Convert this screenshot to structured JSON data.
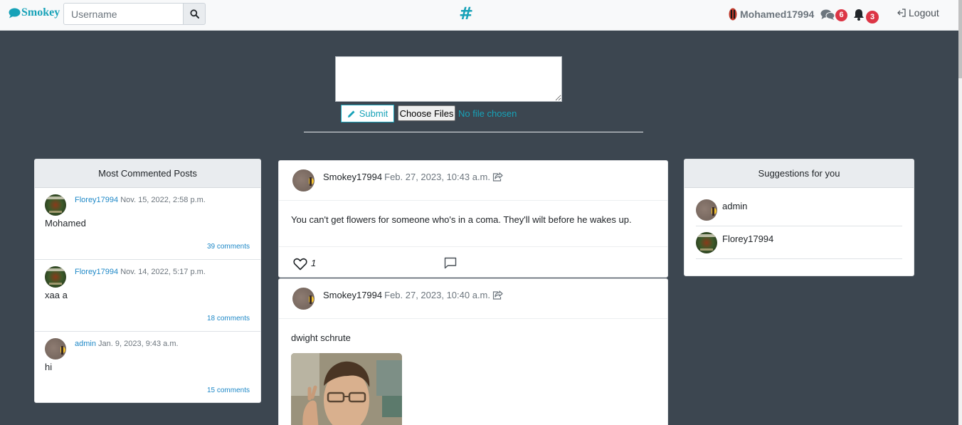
{
  "navbar": {
    "brand": "Smokey",
    "search_placeholder": "Username",
    "hash": "#",
    "username": "Mohamed17994",
    "messages_count": "6",
    "notifications_count": "3",
    "logout_label": "Logout"
  },
  "post_form": {
    "submit_label": "Submit",
    "choose_files_label": "Choose Files",
    "no_file_label": "No file chosen"
  },
  "most_commented": {
    "title": "Most Commented Posts",
    "items": [
      {
        "author": "Florey17994",
        "date": "Nov. 15, 2022, 2:58 p.m.",
        "text": "Mohamed",
        "comments": "39 comments"
      },
      {
        "author": "Florey17994",
        "date": "Nov. 14, 2022, 5:17 p.m.",
        "text": "xaa a",
        "comments": "18 comments"
      },
      {
        "author": "admin",
        "date": "Jan. 9, 2023, 9:43 a.m.",
        "text": "hi",
        "comments": "15 comments"
      }
    ]
  },
  "feed": {
    "posts": [
      {
        "author": "Smokey17994",
        "date": "Feb. 27, 2023, 10:43 a.m.",
        "text": "You can't get flowers for someone who's in a coma. They'll wilt before he wakes up.",
        "likes": "1"
      },
      {
        "author": "Smokey17994",
        "date": "Feb. 27, 2023, 10:40 a.m.",
        "text": "dwight schrute"
      }
    ]
  },
  "suggestions": {
    "title": "Suggestions for you",
    "users": [
      {
        "name": "admin"
      },
      {
        "name": "Florey17994"
      }
    ]
  },
  "colors": {
    "accent": "#17a2b8",
    "badge": "#dc3545",
    "background": "#3c4650"
  }
}
